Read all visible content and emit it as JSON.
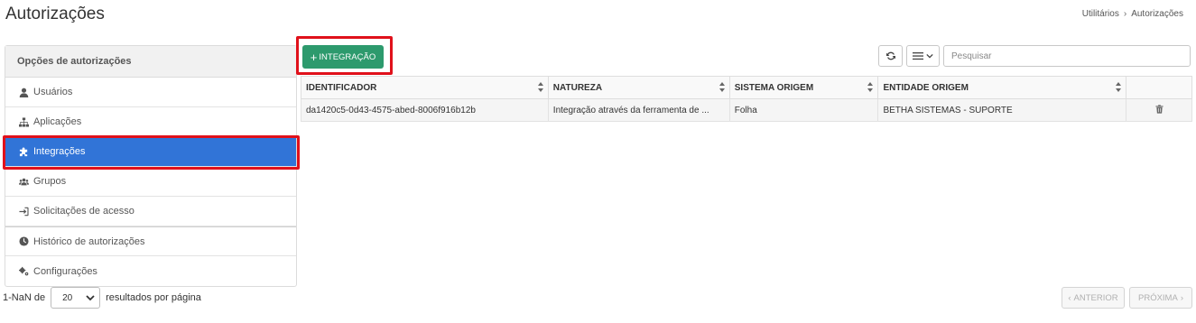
{
  "header": {
    "title": "Autorizações",
    "breadcrumb": [
      "Utilitários",
      "Autorizações"
    ]
  },
  "sidebar": {
    "title": "Opções de autorizações",
    "items": [
      {
        "label": "Usuários",
        "icon": "user-icon",
        "active": false
      },
      {
        "label": "Aplicações",
        "icon": "sitemap-icon",
        "active": false
      },
      {
        "label": "Integrações",
        "icon": "puzzle-icon",
        "active": true
      },
      {
        "label": "Grupos",
        "icon": "users-icon",
        "active": false
      },
      {
        "label": "Solicitações de acesso",
        "icon": "sign-in-icon",
        "active": false
      },
      {
        "label": "Histórico de autorizações",
        "icon": "clock-icon",
        "active": false
      },
      {
        "label": "Configurações",
        "icon": "gears-icon",
        "active": false
      }
    ]
  },
  "toolbar": {
    "add_label": "INTEGRAÇÃO",
    "search_placeholder": "Pesquisar"
  },
  "table": {
    "columns": [
      "IDENTIFICADOR",
      "NATUREZA",
      "SISTEMA ORIGEM",
      "ENTIDADE ORIGEM",
      ""
    ],
    "rows": [
      [
        "da1420c5-0d43-4575-abed-8006f916b12b",
        "Integração através da ferramenta de ...",
        "Folha",
        "BETHA SISTEMAS - SUPORTE"
      ]
    ]
  },
  "pagination": {
    "range_text": "1-NaN de",
    "page_size": "20",
    "suffix": "resultados por página",
    "prev_label": "ANTERIOR",
    "next_label": "PRÓXIMA"
  },
  "colors": {
    "accent": "#3174d7",
    "add_button": "#2d9a6d",
    "highlight": "#e0111b"
  }
}
